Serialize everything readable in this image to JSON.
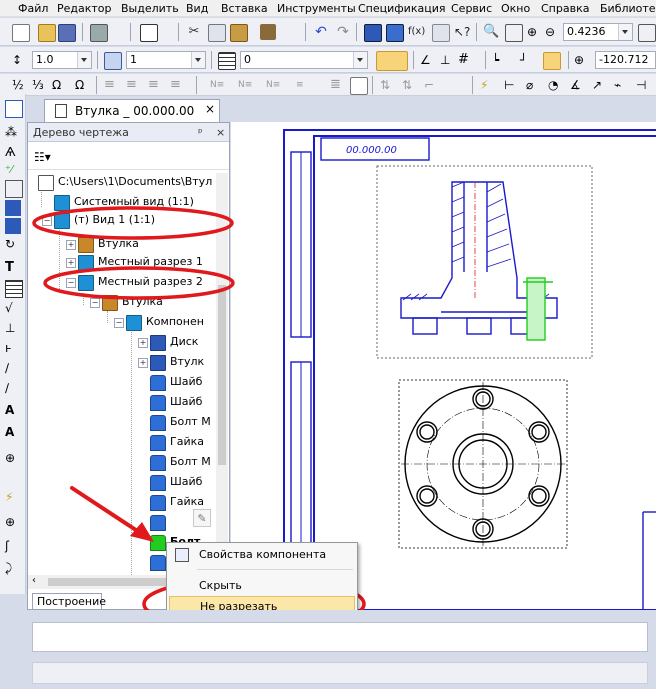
{
  "menu": [
    "Файл",
    "Редактор",
    "Выделить",
    "Вид",
    "Вставка",
    "Инструменты",
    "Спецификация",
    "Сервис",
    "Окно",
    "Справка",
    "Библиотеки"
  ],
  "toolbar": {
    "zoom_value": "0.4236",
    "line_scale": "1.0",
    "layer_value": "1",
    "style_value": "0",
    "coord_value": "-120.712"
  },
  "document_tab": "Втулка _ 00.000.00",
  "panel": {
    "title": "Дерево чертежа",
    "pin": "ᵖ",
    "close": "×",
    "bottom_tab": "Построение"
  },
  "tree": [
    {
      "label": "C:\\Users\\1\\Documents\\Втул",
      "level": 0
    },
    {
      "label": "Системный вид (1:1)",
      "level": 1
    },
    {
      "label": "(т) Вид 1 (1:1)",
      "level": 1
    },
    {
      "label": "Втулка",
      "level": 2
    },
    {
      "label": "Местный разрез 1",
      "level": 2
    },
    {
      "label": "Местный разрез 2",
      "level": 2
    },
    {
      "label": "Втулка",
      "level": 3
    },
    {
      "label": "Компонен",
      "level": 4
    },
    {
      "label": "Диск",
      "level": 5
    },
    {
      "label": "Втулк",
      "level": 5
    },
    {
      "label": "Шайб",
      "level": 5
    },
    {
      "label": "Шайб",
      "level": 5
    },
    {
      "label": "Болт М",
      "level": 5
    },
    {
      "label": "Гайка",
      "level": 5
    },
    {
      "label": "Болт М",
      "level": 5
    },
    {
      "label": "Шайб",
      "level": 5
    },
    {
      "label": "Гайка",
      "level": 5
    },
    {
      "label": "",
      "level": 5
    },
    {
      "label": "Болт",
      "level": 5
    },
    {
      "label": "",
      "level": 5
    }
  ],
  "context_menu": {
    "items": [
      "Свойства компонента",
      "Скрыть",
      "Не разрезать"
    ],
    "highlighted": "Не разрезать"
  },
  "drawing": {
    "title_block_text": "00.000.00"
  },
  "colors": {
    "annotation_red": "#e0191c",
    "drawing_blue": "#1a1acd",
    "highlight_menu": "#fbe7a8",
    "component_green": "#22cc22"
  }
}
